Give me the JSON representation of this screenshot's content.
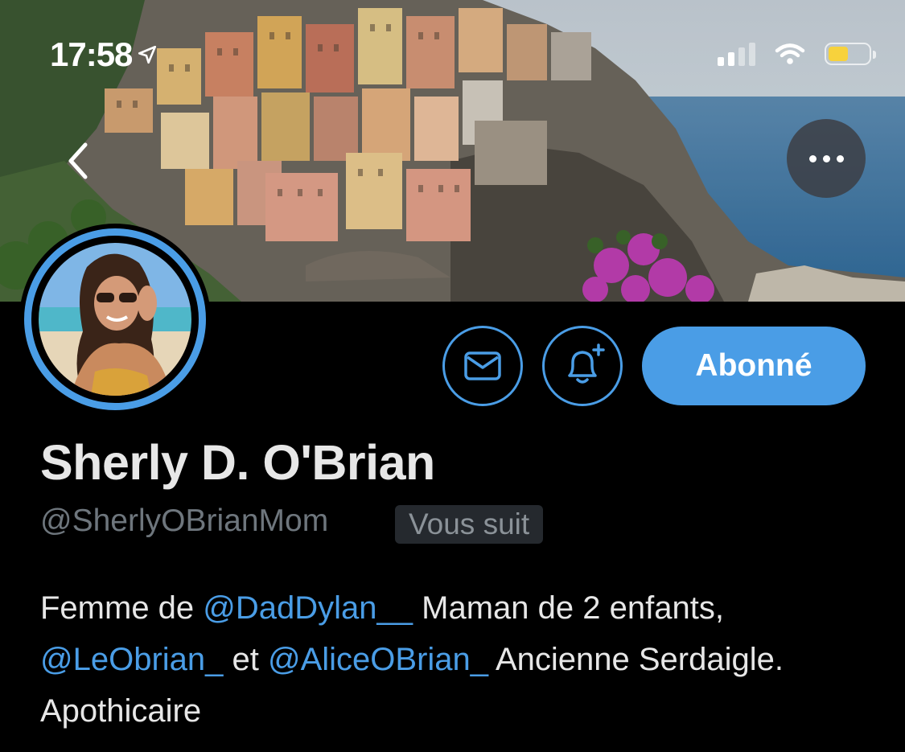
{
  "status_bar": {
    "time": "17:58",
    "location_icon": "location-arrow-icon",
    "signal_icon": "cellular-signal-icon",
    "wifi_icon": "wifi-icon",
    "battery_icon": "battery-icon",
    "battery_level": 0.5,
    "battery_color": "#f7d23c"
  },
  "header": {
    "back_icon": "chevron-left-icon",
    "more_icon": "more-horizontal-icon"
  },
  "actions": {
    "message_icon": "envelope-icon",
    "notify_icon": "bell-plus-icon",
    "follow_label": "Abonné"
  },
  "profile": {
    "name": "Sherly D. O'Brian",
    "handle": "@SherlyOBrianMom",
    "follows_you_label": "Vous suit",
    "bio": {
      "t1": "Femme de ",
      "m1": "@DadDylan__",
      "t2": " Maman de 2 enfants, ",
      "m2": "@LeObrian_",
      "t3": " et ",
      "m3": "@AliceOBrian_",
      "t4": " Ancienne Serdaigle. Apothicaire"
    }
  },
  "colors": {
    "accent": "#4a9de6",
    "background": "#000000",
    "text": "#e7e7e7",
    "secondary_text": "#6e767d"
  }
}
